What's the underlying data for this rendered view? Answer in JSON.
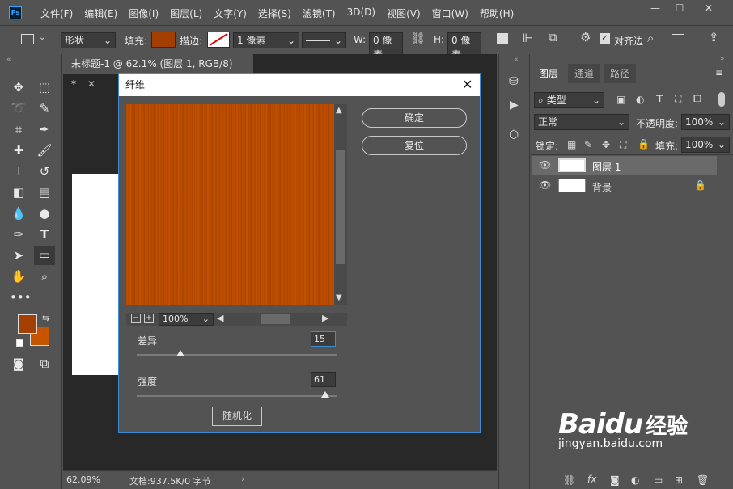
{
  "app": {
    "logo": "Ps"
  },
  "menu": [
    "文件(F)",
    "编辑(E)",
    "图像(I)",
    "图层(L)",
    "文字(Y)",
    "选择(S)",
    "滤镜(T)",
    "3D(D)",
    "视图(V)",
    "窗口(W)",
    "帮助(H)"
  ],
  "options": {
    "shape_mode": "形状",
    "fill_label": "填充:",
    "fill_color": "#a33f00",
    "stroke_label": "描边:",
    "stroke_width": "1 像素",
    "w_label": "W:",
    "w_value": "0 像素",
    "h_label": "H:",
    "h_value": "0 像素",
    "align_edges": "对齐边"
  },
  "doc": {
    "tab_title": "未标题-1 @ 62.1% (图层 1, RGB/8) *",
    "zoom": "62.09%",
    "doc_info": "文档:937.5K/0 字节"
  },
  "colors": {
    "foreground": "#a33f00",
    "background": "#c75500",
    "accent": "#3c8bd4"
  },
  "dialog": {
    "title": "纤维",
    "ok": "确定",
    "reset": "复位",
    "zoom": "100%",
    "variance_label": "差异",
    "variance_value": "15",
    "strength_label": "强度",
    "strength_value": "61",
    "randomize": "随机化"
  },
  "layers_panel": {
    "tabs": [
      "图层",
      "通道",
      "路径"
    ],
    "filter_kind": "类型",
    "blend_mode": "正常",
    "opacity_label": "不透明度:",
    "opacity_value": "100%",
    "lock_label": "锁定:",
    "fill_label": "填充:",
    "fill_value": "100%",
    "layers": [
      {
        "name": "图层 1",
        "selected": true
      },
      {
        "name": "背景",
        "locked": true
      }
    ]
  },
  "watermark": {
    "brand": "Baidu",
    "text": "经验",
    "url": "jingyan.baidu.com"
  }
}
